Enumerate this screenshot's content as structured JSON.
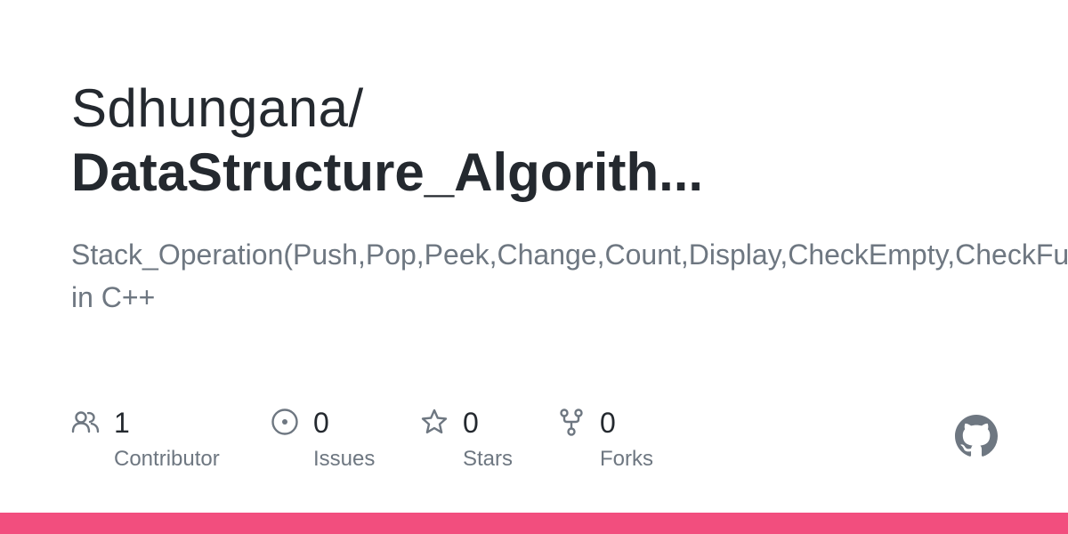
{
  "repo": {
    "owner": "Sdhungana/",
    "name": "DataStructure_Algorith...",
    "description_line1": "Stack_Operation(Push,Pop,Peek,Change,Count,Display,CheckEmpty,CheckFull)",
    "description_line2": "in C++"
  },
  "stats": {
    "contributors": {
      "value": "1",
      "label": "Contributor",
      "icon": "people-icon"
    },
    "issues": {
      "value": "0",
      "label": "Issues",
      "icon": "issue-opened-icon"
    },
    "stars": {
      "value": "0",
      "label": "Stars",
      "icon": "star-icon"
    },
    "forks": {
      "value": "0",
      "label": "Forks",
      "icon": "repo-forked-icon"
    }
  },
  "logo": {
    "icon": "github-mark-icon"
  },
  "colors": {
    "title": "#24292f",
    "muted": "#6e7781",
    "bottom_bar": "#f24e7e"
  }
}
